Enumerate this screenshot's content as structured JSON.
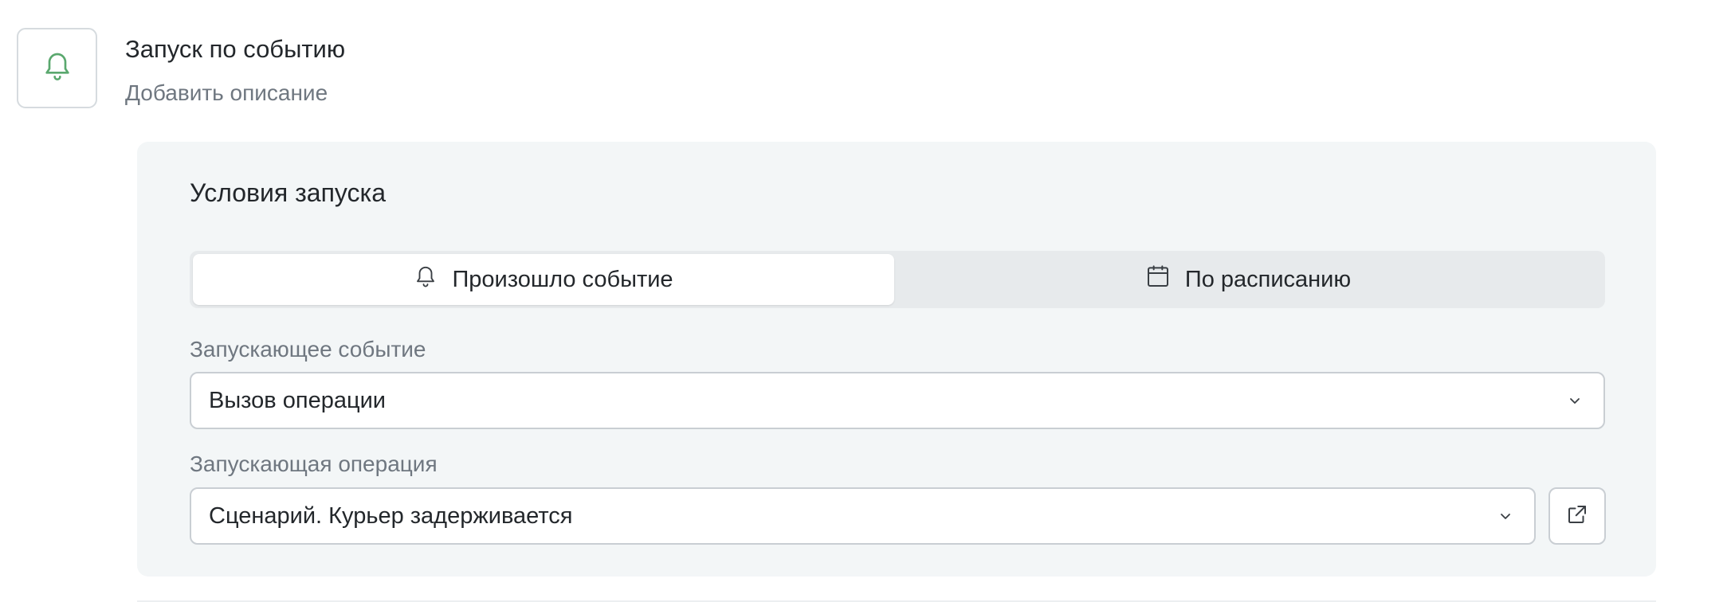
{
  "header": {
    "icon": "bell-icon",
    "icon_color": "#5aa86e",
    "title": "Запуск по событию",
    "description_placeholder": "Добавить описание"
  },
  "trigger_panel": {
    "title": "Условия запуска",
    "mode_tabs": [
      {
        "label": "Произошло событие",
        "icon": "bell-icon",
        "selected": true
      },
      {
        "label": "По расписанию",
        "icon": "calendar-icon",
        "selected": false
      }
    ],
    "event_field": {
      "label": "Запускающее событие",
      "value": "Вызов операции"
    },
    "operation_field": {
      "label": "Запускающая операция",
      "value": "Сценарий. Курьер задерживается",
      "open_icon": "external-link-icon"
    }
  },
  "colors": {
    "panel_background": "#f3f6f7",
    "segmented_background": "#e7eaec",
    "border": "#c9ced3",
    "muted_text": "#6f7780"
  }
}
